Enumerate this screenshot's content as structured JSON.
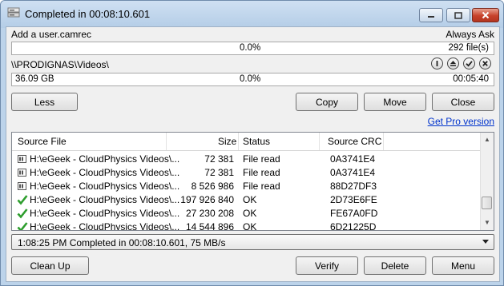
{
  "window": {
    "title": "Completed in 00:08:10.601",
    "minimize": "–",
    "maximize": "▢",
    "close": "✕"
  },
  "task": {
    "name": "Add a user.camrec",
    "mode": "Always Ask",
    "file_progress": "0.0%",
    "file_count": "292 file(s)"
  },
  "destination": {
    "path": "\\\\PRODIGNAS\\Videos\\",
    "size": "36.09 GB",
    "progress": "0.0%",
    "time": "00:05:40"
  },
  "buttons": {
    "less": "Less",
    "copy": "Copy",
    "move": "Move",
    "close": "Close",
    "clean_up": "Clean Up",
    "verify": "Verify",
    "delete": "Delete",
    "menu": "Menu"
  },
  "links": {
    "get_pro": "Get Pro version"
  },
  "table": {
    "columns": [
      "Source File",
      "Size",
      "Status",
      "Source CRC"
    ],
    "rows": [
      {
        "icon": "file-read-icon",
        "file": "H:\\eGeek - CloudPhysics Videos\\...",
        "size": "72 381",
        "status": "File read",
        "crc": "0A3741E4"
      },
      {
        "icon": "file-read-icon",
        "file": "H:\\eGeek - CloudPhysics Videos\\...",
        "size": "72 381",
        "status": "File read",
        "crc": "0A3741E4"
      },
      {
        "icon": "file-read-icon",
        "file": "H:\\eGeek - CloudPhysics Videos\\...",
        "size": "8 526 986",
        "status": "File read",
        "crc": "88D27DF3"
      },
      {
        "icon": "check-icon",
        "file": "H:\\eGeek - CloudPhysics Videos\\...",
        "size": "197 926 840",
        "status": "OK",
        "crc": "2D73E6FE"
      },
      {
        "icon": "check-icon",
        "file": "H:\\eGeek - CloudPhysics Videos\\...",
        "size": "27 230 208",
        "status": "OK",
        "crc": "FE67A0FD"
      },
      {
        "icon": "check-icon",
        "file": "H:\\eGeek - CloudPhysics Videos\\...",
        "size": "14 544 896",
        "status": "OK",
        "crc": "6D21225D"
      }
    ]
  },
  "status_combo": {
    "value": "1:08:25 PM Completed in 00:08:10.601, 75 MB/s"
  },
  "colors": {
    "accent_link": "#0033cc",
    "check_green": "#2e9e2e",
    "title_bar": "#bcd3ea"
  }
}
